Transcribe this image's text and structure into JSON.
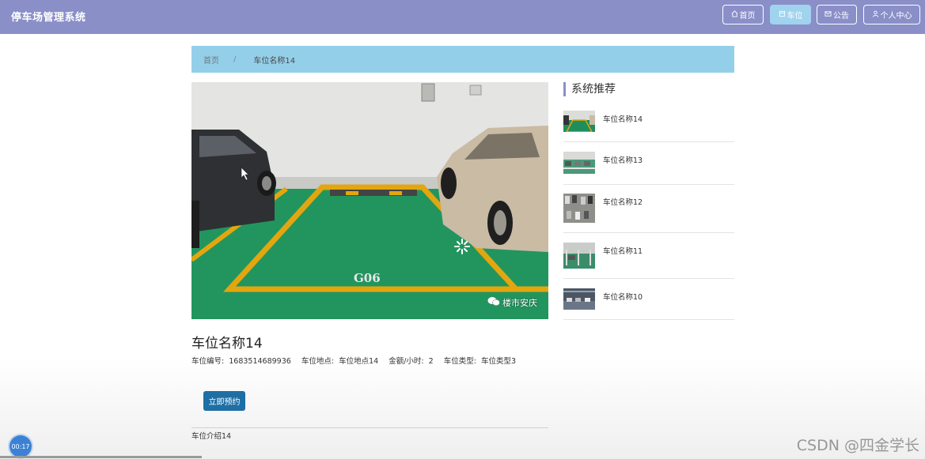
{
  "header": {
    "brand": "停车场管理系统",
    "nav": [
      {
        "label": "首页",
        "icon": "home-icon",
        "active": false
      },
      {
        "label": "车位",
        "icon": "parking-icon",
        "active": true
      },
      {
        "label": "公告",
        "icon": "mail-icon",
        "active": false
      },
      {
        "label": "个人中心",
        "icon": "user-icon",
        "active": false
      }
    ]
  },
  "breadcrumb": {
    "home": "首页",
    "separator": "/",
    "current": "车位名称14"
  },
  "photo": {
    "bay_code": "G06",
    "watermark": "楼市安庆"
  },
  "detail": {
    "title": "车位名称14",
    "fields": {
      "number_label": "车位编号:",
      "number_value": "1683514689936",
      "location_label": "车位地点:",
      "location_value": "车位地点14",
      "price_label": "金额/小时:",
      "price_value": "2",
      "type_label": "车位类型:",
      "type_value": "车位类型3"
    },
    "book_button": "立即预约",
    "intro": "车位介绍14"
  },
  "sidebar": {
    "title": "系统推荐",
    "items": [
      {
        "label": "车位名称14"
      },
      {
        "label": "车位名称13"
      },
      {
        "label": "车位名称12"
      },
      {
        "label": "车位名称11"
      },
      {
        "label": "车位名称10"
      }
    ]
  },
  "player": {
    "time": "00:17"
  },
  "watermark": "CSDN @四金学长",
  "colors": {
    "header": "#8a8fc8",
    "nav_active": "#9fd3ee",
    "breadcrumb": "#94cfea",
    "button": "#1e6fa5"
  }
}
